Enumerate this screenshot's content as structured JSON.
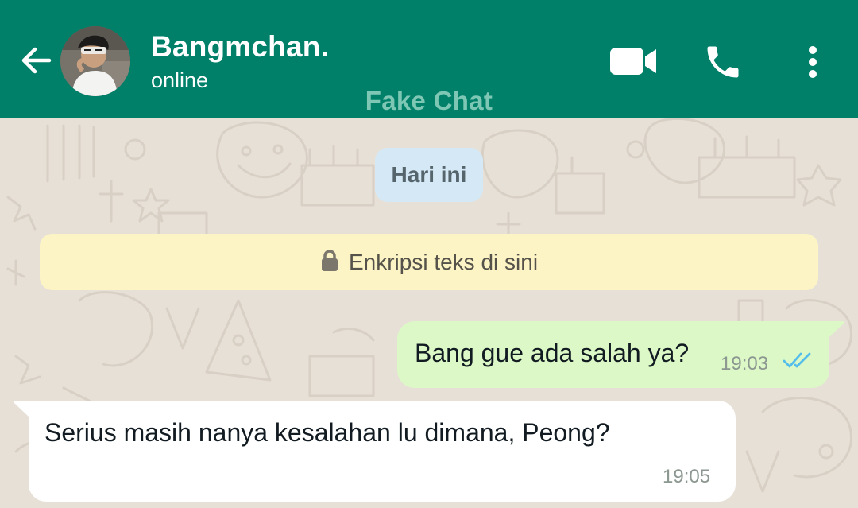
{
  "header": {
    "contact_name": "Bangmchan.",
    "status": "online",
    "watermark": "Fake Chat",
    "icons": [
      "back-arrow-icon",
      "video-call-icon",
      "phone-icon",
      "more-vert-icon"
    ],
    "color": "#008069"
  },
  "chat": {
    "date_chip": "Hari ini",
    "encryption_notice": "Enkripsi teks di sini",
    "messages": [
      {
        "direction": "outgoing",
        "text": "Bang gue ada salah ya?",
        "time": "19:03",
        "status": "read"
      },
      {
        "direction": "incoming",
        "text": "Serius masih nanya kesalahan lu dimana, Peong?",
        "time": "19:05"
      }
    ]
  },
  "colors": {
    "wallpaper": "#e7e0d7",
    "outgoing_bubble": "#dcf8c6",
    "incoming_bubble": "#ffffff",
    "date_chip": "#d4e9f5",
    "encryption_banner": "#fdf4c5",
    "read_ticks": "#53bdeb"
  }
}
